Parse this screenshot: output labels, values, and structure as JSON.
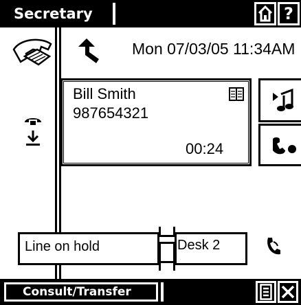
{
  "header": {
    "title": "Secretary",
    "home_icon": "home-icon",
    "help_label": "?"
  },
  "status": {
    "datetime": "Mon 07/03/05 11:34AM",
    "phone_icon": "phone-icon",
    "call_arrow_icon": "return-arrow-icon"
  },
  "call": {
    "name": "Bill Smith",
    "number": "987654321",
    "duration": "00:24",
    "phonebook_icon": "phonebook-icon"
  },
  "left_controls": {
    "hangup_icon": "hangup-handset-icon",
    "download_icon": "download-arrow-icon"
  },
  "right_actions": [
    {
      "icon": "play-audio-icon"
    },
    {
      "icon": "conference-icon"
    }
  ],
  "lines": {
    "hold_label": "Line on hold",
    "desk_label": "Desk 2",
    "pickup_icon": "pickup-handset-icon"
  },
  "footer": {
    "softkey_label": "Consult/Transfer",
    "list_icon": "list-icon",
    "close_icon": "close-icon"
  }
}
